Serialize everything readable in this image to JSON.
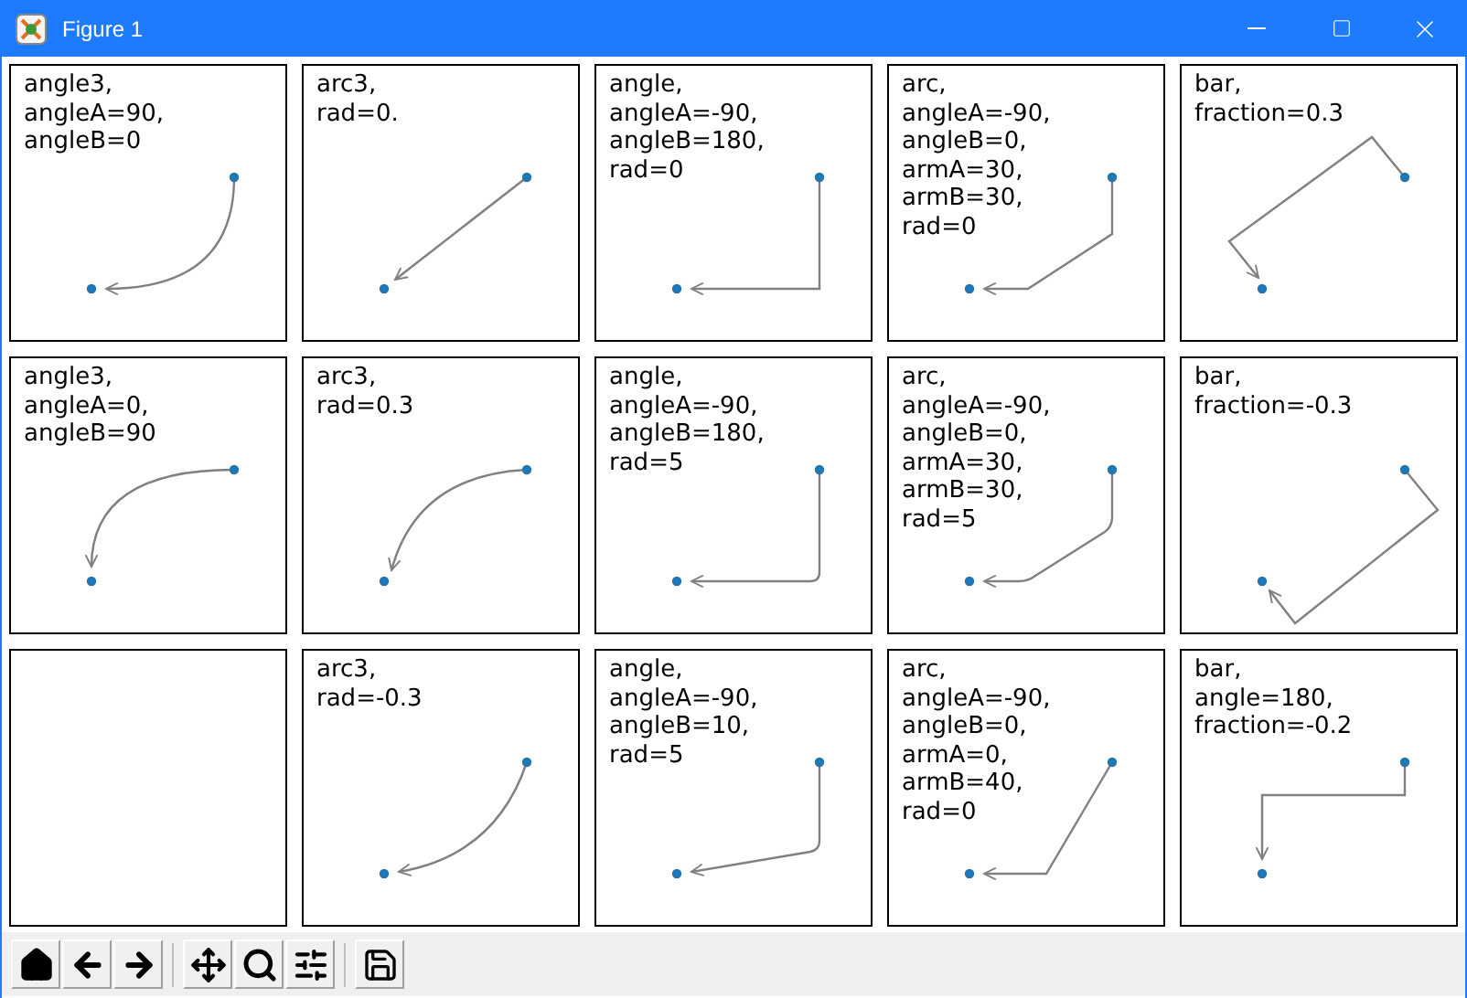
{
  "window": {
    "title": "Figure 1"
  },
  "panels": [
    {
      "kind": "demo",
      "label": "angle3,\nangleA=90,\nangleB=0"
    },
    {
      "kind": "demo",
      "label": "arc3,\nrad=0."
    },
    {
      "kind": "demo",
      "label": "angle,\nangleA=-90,\nangleB=180,\nrad=0"
    },
    {
      "kind": "demo",
      "label": "arc,\nangleA=-90,\nangleB=0,\narmA=30,\narmB=30,\nrad=0"
    },
    {
      "kind": "demo",
      "label": "bar,\nfraction=0.3"
    },
    {
      "kind": "demo",
      "label": "angle3,\nangleA=0,\nangleB=90"
    },
    {
      "kind": "demo",
      "label": "arc3,\nrad=0.3"
    },
    {
      "kind": "demo",
      "label": "angle,\nangleA=-90,\nangleB=180,\nrad=5"
    },
    {
      "kind": "demo",
      "label": "arc,\nangleA=-90,\nangleB=0,\narmA=30,\narmB=30,\nrad=5"
    },
    {
      "kind": "demo",
      "label": "bar,\nfraction=-0.3"
    },
    {
      "kind": "blank"
    },
    {
      "kind": "demo",
      "label": "arc3,\nrad=-0.3"
    },
    {
      "kind": "demo",
      "label": "angle,\nangleA=-90,\nangleB=10,\nrad=5"
    },
    {
      "kind": "demo",
      "label": "arc,\nangleA=-90,\nangleB=0,\narmA=0,\narmB=40,\nrad=0"
    },
    {
      "kind": "demo",
      "label": "bar,\nangle=180,\nfraction=-0.2"
    }
  ]
}
